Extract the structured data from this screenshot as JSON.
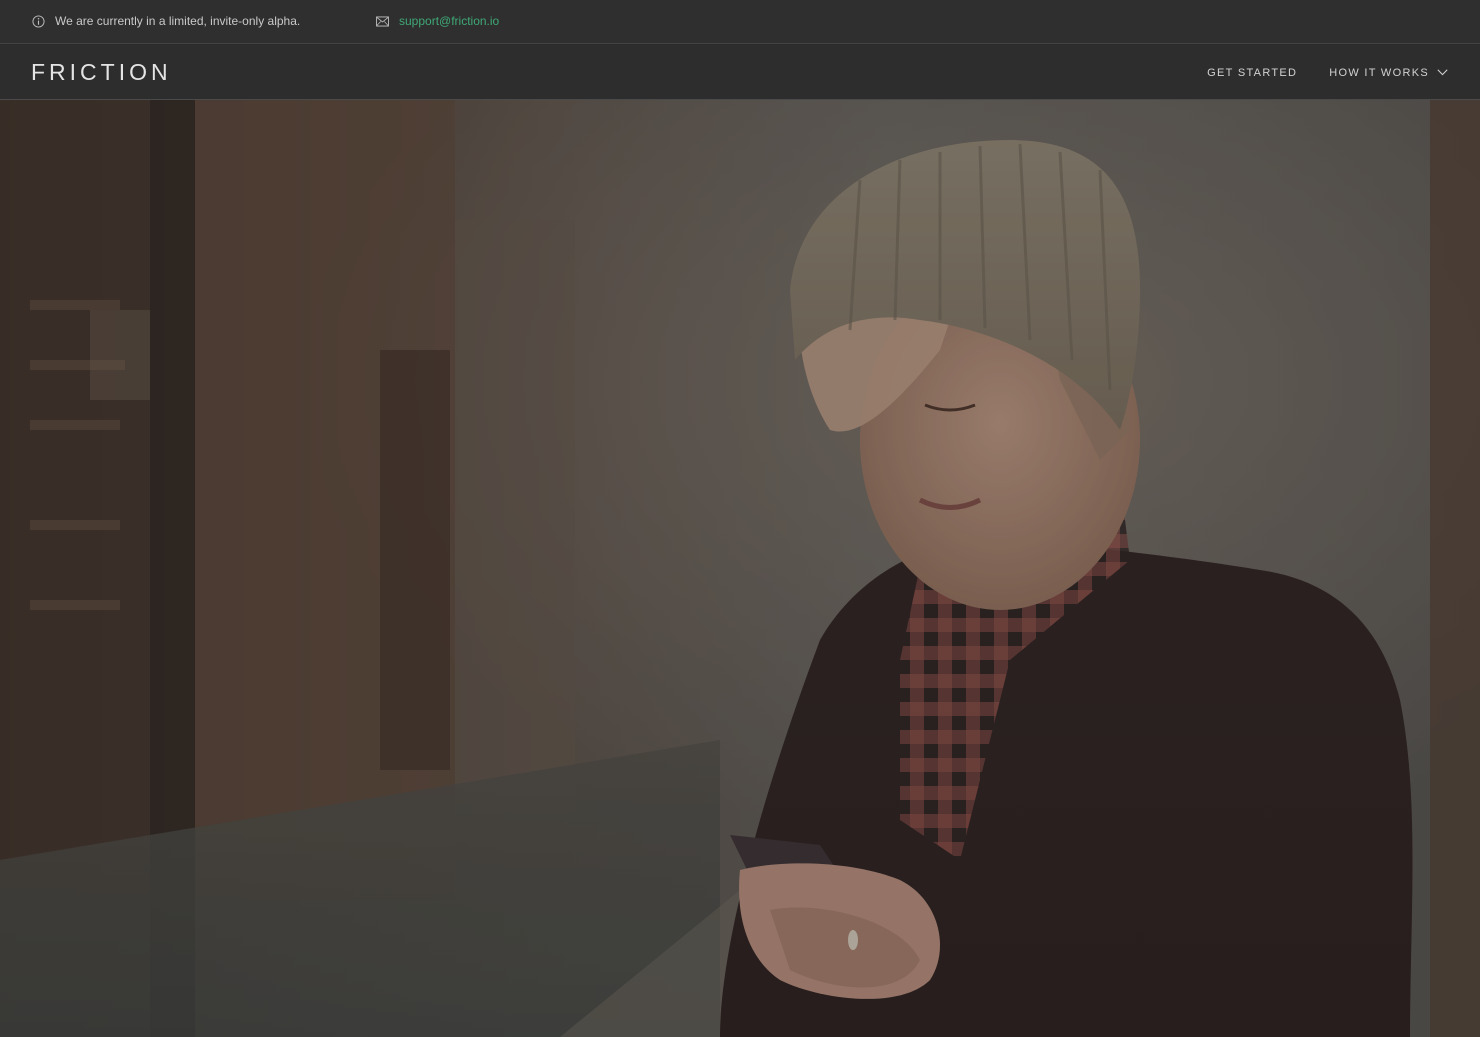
{
  "topbar": {
    "notice": "We are currently in a limited, invite-only alpha.",
    "notice_icon": "info-circle-icon",
    "email_icon": "envelope-icon",
    "email": "support@friction.io"
  },
  "nav": {
    "brand": "FRICTION",
    "links": [
      {
        "label": "GET STARTED"
      },
      {
        "label": "HOW IT WORKS",
        "has_dropdown": true
      }
    ]
  },
  "hero": {
    "image": "woman-using-smartphone-street-photo"
  },
  "colors": {
    "link_accent": "#3fa876",
    "bar_bg": "#2f2f2f",
    "nav_bg": "#2d2d2d"
  }
}
